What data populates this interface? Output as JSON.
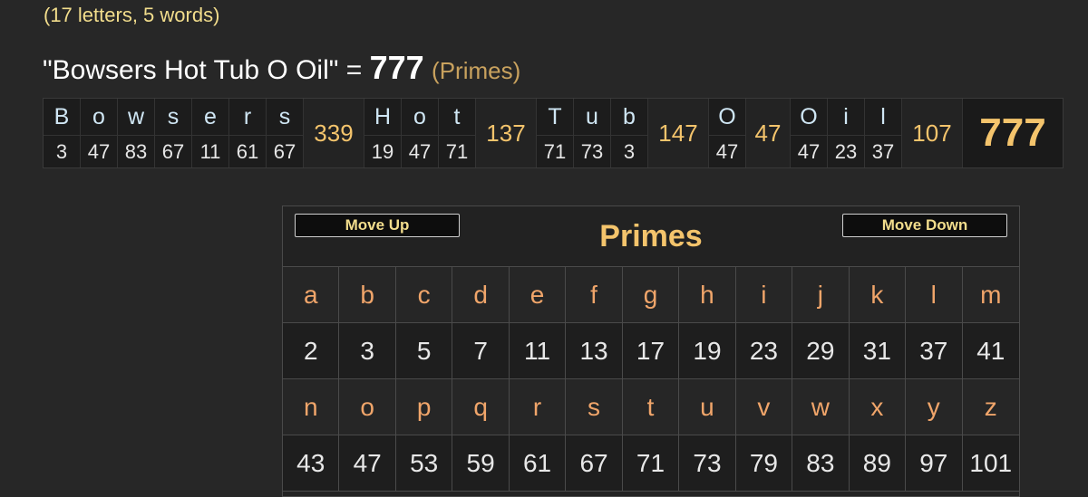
{
  "header": {
    "subtitle": "(17 letters, 5 words)",
    "phrase": "\"Bowsers Hot Tub O Oil\"",
    "equals": "=",
    "total": "777",
    "cipher_label": "(Primes)"
  },
  "breakdown": {
    "words": [
      {
        "letters": [
          "B",
          "o",
          "w",
          "s",
          "e",
          "r",
          "s"
        ],
        "values": [
          "3",
          "47",
          "83",
          "67",
          "11",
          "61",
          "67"
        ],
        "sum": "339"
      },
      {
        "letters": [
          "H",
          "o",
          "t"
        ],
        "values": [
          "19",
          "47",
          "71"
        ],
        "sum": "137"
      },
      {
        "letters": [
          "T",
          "u",
          "b"
        ],
        "values": [
          "71",
          "73",
          "3"
        ],
        "sum": "147"
      },
      {
        "letters": [
          "O"
        ],
        "values": [
          "47"
        ],
        "sum": "47"
      },
      {
        "letters": [
          "O",
          "i",
          "l"
        ],
        "values": [
          "47",
          "23",
          "37"
        ],
        "sum": "107"
      }
    ],
    "grand_total": "777"
  },
  "panel": {
    "title": "Primes",
    "move_up_label": "Move Up",
    "move_down_label": "Move Down",
    "rows": [
      {
        "letters": [
          "a",
          "b",
          "c",
          "d",
          "e",
          "f",
          "g",
          "h",
          "i",
          "j",
          "k",
          "l",
          "m"
        ],
        "values": [
          "2",
          "3",
          "5",
          "7",
          "11",
          "13",
          "17",
          "19",
          "23",
          "29",
          "31",
          "37",
          "41"
        ]
      },
      {
        "letters": [
          "n",
          "o",
          "p",
          "q",
          "r",
          "s",
          "t",
          "u",
          "v",
          "w",
          "x",
          "y",
          "z"
        ],
        "values": [
          "43",
          "47",
          "53",
          "59",
          "61",
          "67",
          "71",
          "73",
          "79",
          "83",
          "89",
          "97",
          "101"
        ]
      }
    ]
  },
  "colors": {
    "background": "#272727",
    "accent_gold": "#f4c46c",
    "letter_orange": "#f0a56a",
    "breakdown_letter": "#cfe6f4",
    "subtitle_yellow": "#f2dd8c"
  }
}
